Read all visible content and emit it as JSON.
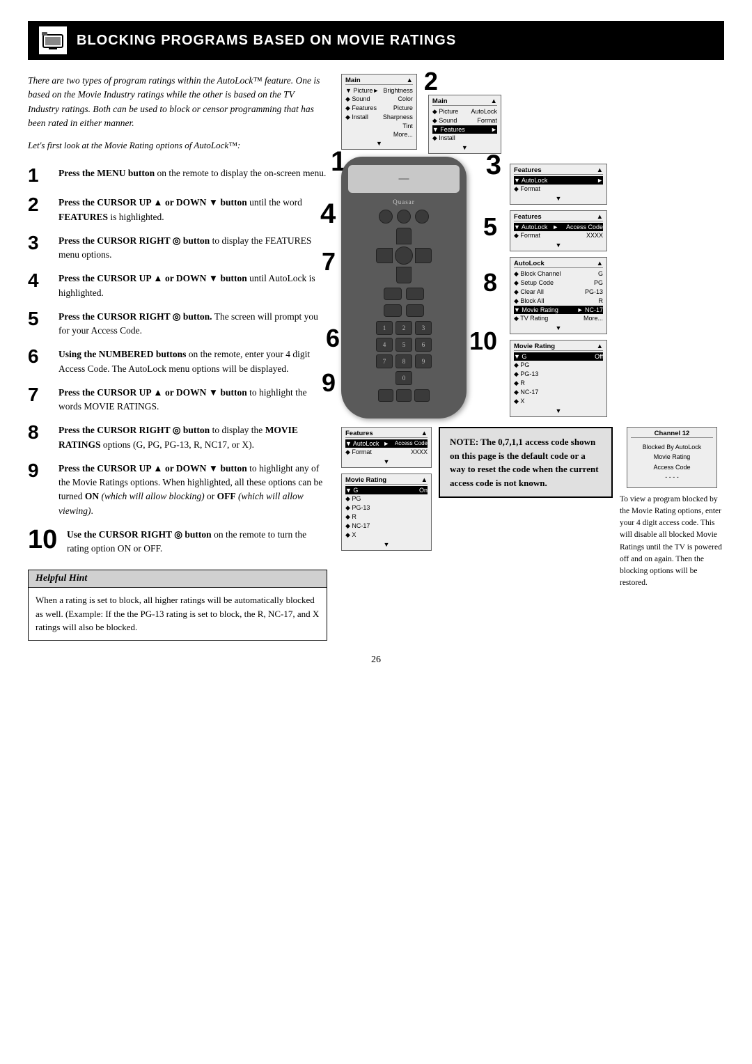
{
  "header": {
    "title": "Blocking Programs Based on Movie Ratings",
    "icon_label": "tv-icon"
  },
  "intro": {
    "paragraph1": "There are two types of program ratings within the AutoLock™ feature. One is based on the Movie Industry ratings while the other is based on the TV Industry ratings. Both can be used to block or censor programming that has been rated in either manner.",
    "paragraph2": "Let's first look at the Movie Rating options of AutoLock™:"
  },
  "steps": [
    {
      "num": "1",
      "text": "Press the MENU button on the remote to display the on-screen menu."
    },
    {
      "num": "2",
      "text": "Press the CURSOR UP ▲ or DOWN ▼ button until the word FEATURES is highlighted."
    },
    {
      "num": "3",
      "text": "Press the CURSOR RIGHT ◎ button to display the FEATURES menu options."
    },
    {
      "num": "4",
      "text": "Press the CURSOR UP ▲ or DOWN ▼ button until AutoLock is highlighted."
    },
    {
      "num": "5",
      "text": "Press the CURSOR RIGHT ◎ button. The screen will prompt you for your Access Code."
    },
    {
      "num": "6",
      "text": "Using the NUMBERED buttons on the remote, enter your 4 digit Access Code. The AutoLock menu options will be displayed."
    },
    {
      "num": "7",
      "text": "Press the CURSOR UP ▲ or DOWN ▼ button to highlight the words MOVIE RATINGS."
    },
    {
      "num": "8",
      "text": "Press the CURSOR RIGHT ◎ button to display the MOVIE RATINGS options (G, PG, PG-13, R, NC17, or X)."
    },
    {
      "num": "9",
      "text": "Press the CURSOR UP ▲ or DOWN ▼ button to highlight any of the Movie Ratings options. When highlighted, all these options can be turned ON (which will allow blocking) or OFF (which will allow viewing)."
    },
    {
      "num": "10",
      "text": "Use the CURSOR RIGHT ◎ button on the remote to turn the rating option ON or OFF."
    }
  ],
  "helpful_hint": {
    "title": "Helpful Hint",
    "body": "When a rating is set to block, all higher ratings will be automatically blocked as well. (Example: If the the PG-13 rating is set to block, the R, NC-17, and X ratings will also be blocked."
  },
  "note": {
    "bold_text": "NOTE: The 0,7,1,1 access code shown on this page is the default code or a way to reset the code when the current access code is not known."
  },
  "side_note": {
    "text": "To view a program blocked by the Movie Rating options, enter your 4 digit access code. This will disable all blocked Movie Ratings until the TV is powered off and on again. Then the blocking options will be restored."
  },
  "page_number": "26",
  "screens": {
    "screen1": {
      "title": "Main",
      "rows": [
        {
          "label": "▼ Picture",
          "value": "►",
          "sub": "Brightness"
        },
        {
          "label": "◆ Sound",
          "value": "",
          "sub": "Color"
        },
        {
          "label": "◆ Features",
          "value": "",
          "sub": "Picture"
        },
        {
          "label": "◆ Install",
          "value": "",
          "sub": "Sharpness"
        },
        {
          "label": "",
          "value": "",
          "sub": "Tint"
        },
        {
          "label": "",
          "value": "",
          "sub": "More..."
        }
      ]
    },
    "screen2": {
      "title": "Main",
      "rows": [
        {
          "label": "◆ Picture",
          "value": "AutoLock"
        },
        {
          "label": "◆ Sound",
          "value": "Format"
        },
        {
          "label": "▼ Features",
          "value": "►"
        },
        {
          "label": "◆ Install",
          "value": ""
        }
      ]
    },
    "screen3": {
      "title": "Features",
      "rows": [
        {
          "label": "▼ AutoLock",
          "value": "►"
        },
        {
          "label": "◆ Format",
          "value": ""
        }
      ]
    },
    "screen4": {
      "title": "Features",
      "rows": [
        {
          "label": "▼ AutoLock",
          "value": "►",
          "extra": "Access Code"
        },
        {
          "label": "◆ Format",
          "value": "XXXX"
        }
      ]
    },
    "screen5": {
      "title": "AutoLock",
      "rows": [
        {
          "label": "◆ Block Channel",
          "value": "G"
        },
        {
          "label": "◆ Setup Code",
          "value": "PG"
        },
        {
          "label": "◆ Clear All",
          "value": "PG-13"
        },
        {
          "label": "◆ Block All",
          "value": "R"
        },
        {
          "label": "▼ Movie Rating",
          "value": "►",
          "extra": "NC-17"
        },
        {
          "label": "◆ TV Rating",
          "value": "",
          "extra": "More..."
        }
      ]
    },
    "screen6": {
      "title": "Movie Rating",
      "rows": [
        {
          "label": "▼ G",
          "value": "Off"
        },
        {
          "label": "◆ PG",
          "value": ""
        },
        {
          "label": "◆ PG-13",
          "value": ""
        },
        {
          "label": "◆ R",
          "value": ""
        },
        {
          "label": "◆ NC-17",
          "value": ""
        },
        {
          "label": "◆ X",
          "value": ""
        }
      ]
    },
    "screen7": {
      "title": "Movie Rating",
      "rows": [
        {
          "label": "▼ G",
          "value": "On"
        },
        {
          "label": "◆ PG",
          "value": ""
        },
        {
          "label": "◆ PG-13",
          "value": ""
        },
        {
          "label": "◆ R",
          "value": ""
        },
        {
          "label": "◆ NC-17",
          "value": ""
        },
        {
          "label": "◆ X",
          "value": ""
        }
      ]
    },
    "screen8": {
      "title": "Channel 12",
      "rows": [
        {
          "label": "Blocked By AutoLock",
          "value": ""
        },
        {
          "label": "Movie Rating",
          "value": ""
        },
        {
          "label": "Access Code",
          "value": ""
        },
        {
          "label": "- - - -",
          "value": ""
        }
      ]
    }
  },
  "brand": "Quasar"
}
